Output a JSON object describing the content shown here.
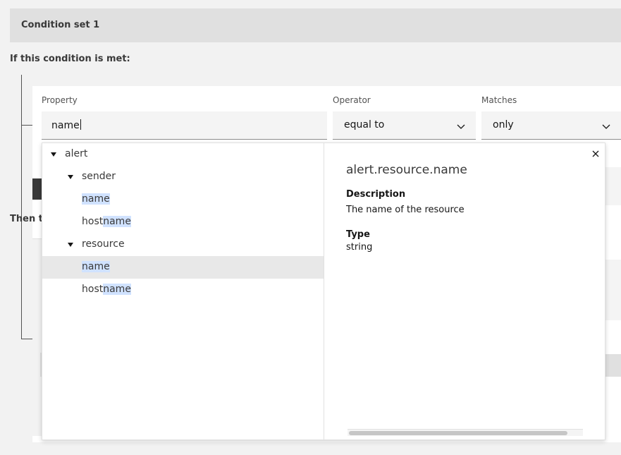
{
  "condition_set": {
    "title": "Condition set 1"
  },
  "condition_label": "If this condition is met:",
  "then_label": "Then ta",
  "fields": {
    "property": {
      "label": "Property",
      "value": "name"
    },
    "operator": {
      "label": "Operator",
      "value": "equal to"
    },
    "matches": {
      "label": "Matches",
      "value": "only"
    }
  },
  "tree": {
    "root": {
      "label": "alert"
    },
    "sender": {
      "label": "sender",
      "items": [
        {
          "prefix": "",
          "match": "name"
        },
        {
          "prefix": "host",
          "match": "name"
        }
      ]
    },
    "resource": {
      "label": "resource",
      "items": [
        {
          "prefix": "",
          "match": "name"
        },
        {
          "prefix": "host",
          "match": "name"
        }
      ]
    }
  },
  "detail": {
    "title": "alert.resource.name",
    "description_heading": "Description",
    "description": "The name of the resource",
    "type_heading": "Type",
    "type": "string"
  },
  "icons": {
    "close": "close-icon",
    "chevron": "chevron-down-icon",
    "caret": "caret-down-icon"
  },
  "colors": {
    "highlight": "#d0e2ff",
    "selected_row": "#e8e8e8",
    "header_bg": "#e0e0e0"
  }
}
